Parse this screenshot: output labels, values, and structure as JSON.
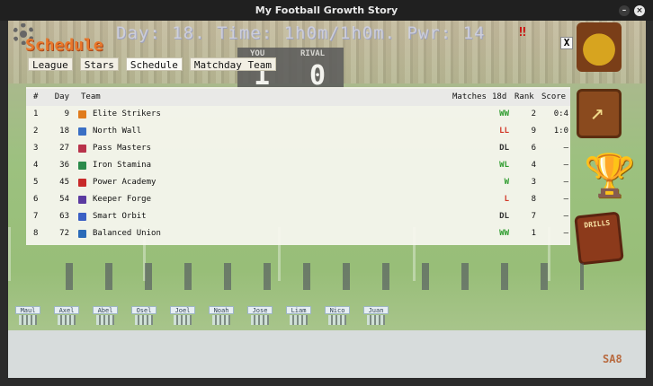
{
  "window": {
    "title": "My Football Growth Story"
  },
  "hud": {
    "status": "Day: 18. Time: 1h0m/1h0m. Pwr: 14",
    "flag": "‼"
  },
  "scoreboard": {
    "you_label": "YOU",
    "rival_label": "RIVAL",
    "you_score": "1",
    "rival_score": "0"
  },
  "screen": {
    "title": "Schedule",
    "close_label": "X"
  },
  "tabs": [
    {
      "label": "League"
    },
    {
      "label": "Stars"
    },
    {
      "label": "Schedule"
    },
    {
      "label": "Matchday Team"
    }
  ],
  "table": {
    "headers": {
      "num": "#",
      "day": "Day",
      "team": "Team",
      "matches": "Matches",
      "d18": "18d",
      "rank": "Rank",
      "score": "Score"
    },
    "rows": [
      {
        "num": "1",
        "day": "9",
        "team": "Elite Strikers",
        "form": "WW",
        "form_color": "#2e9c2e",
        "rank": "2",
        "score": "0:4",
        "icon_color": "#e07b1c"
      },
      {
        "num": "2",
        "day": "18",
        "team": "North Wall",
        "form": "LL",
        "form_color": "#d23a2a",
        "rank": "9",
        "score": "1:0",
        "icon_color": "#3a6fc4"
      },
      {
        "num": "3",
        "day": "27",
        "team": "Pass Masters",
        "form": "DL",
        "form_color": "#333333",
        "rank": "6",
        "score": "–",
        "icon_color": "#b8324a"
      },
      {
        "num": "4",
        "day": "36",
        "team": "Iron Stamina",
        "form": "WL",
        "form_color": "#2e9c2e",
        "rank": "4",
        "score": "–",
        "icon_color": "#2a8a4a"
      },
      {
        "num": "5",
        "day": "45",
        "team": "Power Academy",
        "form": "W",
        "form_color": "#2e9c2e",
        "rank": "3",
        "score": "–",
        "icon_color": "#c82a2a"
      },
      {
        "num": "6",
        "day": "54",
        "team": "Keeper Forge",
        "form": "L",
        "form_color": "#d23a2a",
        "rank": "8",
        "score": "–",
        "icon_color": "#5a3aa0"
      },
      {
        "num": "7",
        "day": "63",
        "team": "Smart Orbit",
        "form": "DL",
        "form_color": "#333333",
        "rank": "7",
        "score": "–",
        "icon_color": "#3a5fc4"
      },
      {
        "num": "8",
        "day": "72",
        "team": "Balanced Union",
        "form": "WW",
        "form_color": "#2e9c2e",
        "rank": "1",
        "score": "–",
        "icon_color": "#2a6ab8"
      }
    ]
  },
  "side_buttons": {
    "drills_label": "DRILLS"
  },
  "squad": [
    "Maul",
    "Axel",
    "Abel",
    "Osel",
    "Joel",
    "Noah",
    "Jose",
    "Liam",
    "Nico",
    "Juan"
  ],
  "footer": {
    "code": "SA8"
  }
}
